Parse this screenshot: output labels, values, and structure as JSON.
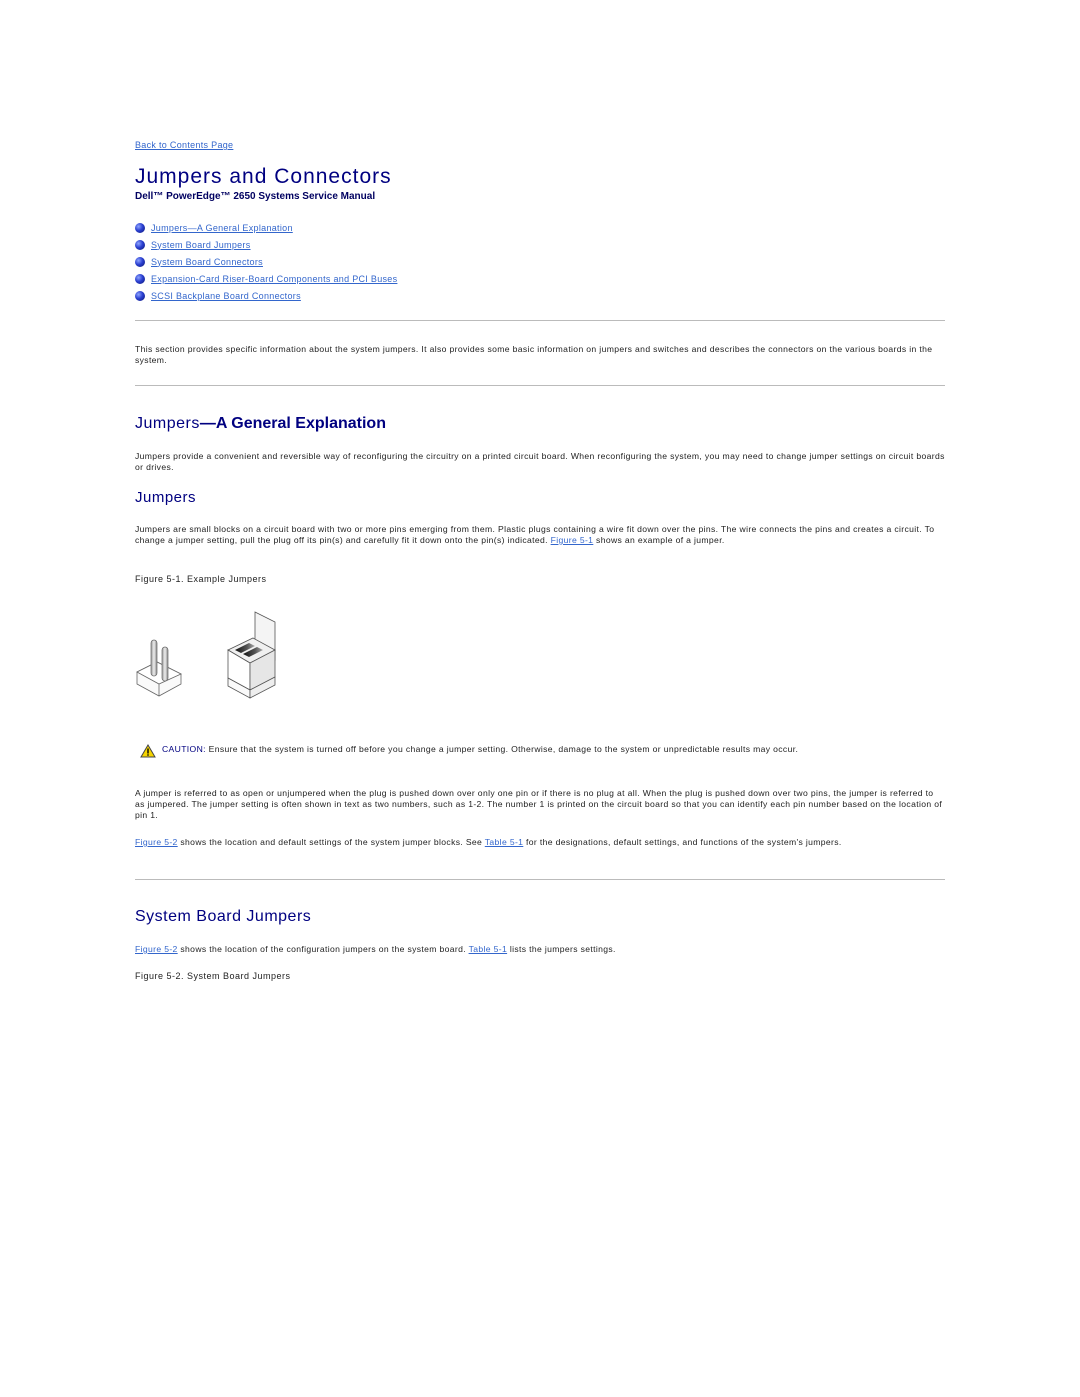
{
  "nav": {
    "back_link": "Back to Contents Page"
  },
  "header": {
    "title": "Jumpers and Connectors",
    "subtitle": "Dell™ PowerEdge™ 2650 Systems Service Manual"
  },
  "toc": {
    "bullet_icon": "blue-sphere-bullet-icon",
    "items": [
      {
        "label": "Jumpers—A General Explanation"
      },
      {
        "label": "System Board Jumpers"
      },
      {
        "label": "System Board Connectors"
      },
      {
        "label": "Expansion-Card Riser-Board Components and PCI Buses"
      },
      {
        "label": "SCSI Backplane Board Connectors"
      }
    ]
  },
  "intro": "This section provides specific information about the system jumpers. It also provides some basic information on jumpers and switches and describes the connectors on the various boards in the system.",
  "general": {
    "heading_light": "Jumpers",
    "heading_bold": "—A General Explanation",
    "paragraph": "Jumpers provide a convenient and reversible way of reconfiguring the circuitry on a printed circuit board. When reconfiguring the system, you may need to change jumper settings on circuit boards or drives.",
    "sub_heading": "Jumpers",
    "jumpers_p1_before": "Jumpers are small blocks on a circuit board with two or more pins emerging from them. Plastic plugs containing a wire fit down over the pins. The wire connects the pins and creates a circuit. To change a jumper setting, pull the plug off its pin(s) and carefully fit it down onto the pin(s) indicated. ",
    "jumpers_p1_link": "Figure 5-1",
    "jumpers_p1_after": " shows an example of a jumper.",
    "figure_caption": "Figure 5-1. Example Jumpers",
    "caution_label": "CAUTION:",
    "caution_text": " Ensure that the system is turned off before you change a jumper setting. Otherwise, damage to the system or unpredictable results may occur.",
    "jumpered_p": "A jumper is referred to as open or unjumpered when the plug is pushed down over only one pin or if there is no plug at all. When the plug is pushed down over two pins, the jumper is referred to as jumpered. The jumper setting is often shown in text as two numbers, such as 1-2. The number 1 is printed on the circuit board so that you can identify each pin number based on the location of pin 1.",
    "location_link1": "Figure 5-2",
    "location_mid": " shows the location and default settings of the system jumper blocks. See ",
    "location_link2": "Table 5-1",
    "location_after": " for the designations, default settings, and functions of the system's jumpers."
  },
  "system_board": {
    "heading": "System Board Jumpers",
    "link1": "Figure 5-2",
    "mid": " shows the location of the configuration jumpers on the system board. ",
    "link2": "Table 5-1",
    "after": " lists the jumpers settings.",
    "figure_caption": "Figure 5-2. System Board Jumpers"
  }
}
